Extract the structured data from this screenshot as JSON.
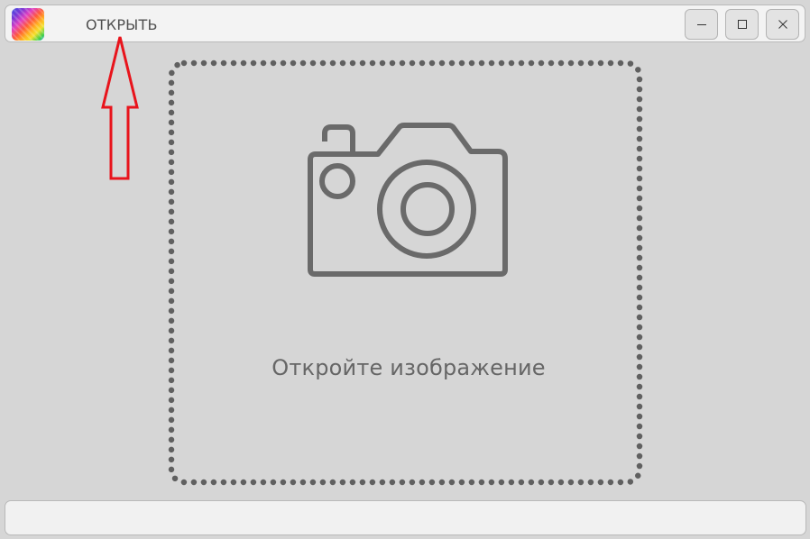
{
  "header": {
    "app_icon": "rainbow-gradient-app-icon",
    "open_label": "ОТКРЫТЬ",
    "window_controls": {
      "minimize_icon": "minimize-icon",
      "maximize_icon": "maximize-icon",
      "close_icon": "close-icon"
    }
  },
  "main": {
    "dropzone": {
      "icon": "camera-icon",
      "label": "Откройте изображение"
    }
  },
  "status_bar": {
    "text": ""
  },
  "annotation": {
    "icon": "arrow-up-icon",
    "color": "#e8141c"
  },
  "colors": {
    "background": "#d6d6d6",
    "panel": "#f3f3f3",
    "icon_gray": "#6a6a6a",
    "text_gray": "#666666"
  }
}
